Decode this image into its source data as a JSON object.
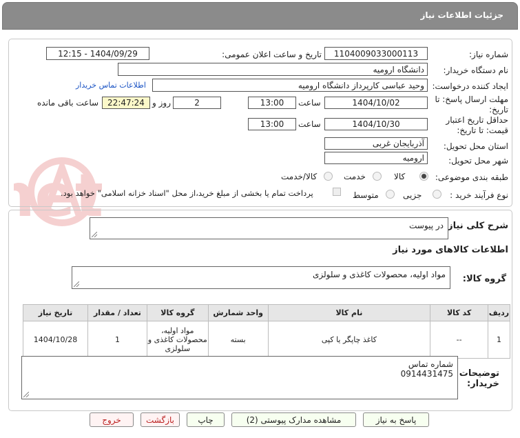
{
  "header": {
    "title": "جزئیات اطلاعات نیاز"
  },
  "need_number": {
    "label": "شماره نیاز:",
    "value": "1104009033000113"
  },
  "announce": {
    "label": "تاریخ و ساعت اعلان عمومی:",
    "value": "1404/09/29 - 12:15"
  },
  "buyer_org": {
    "label": "نام دستگاه خریدار:",
    "value": "دانشگاه ارومیه"
  },
  "requester": {
    "label": "ایجاد کننده درخواست:",
    "value": "وحید عباسی کارپرداز دانشگاه ارومیه",
    "contact_link": "اطلاعات تماس خریدار"
  },
  "deadline": {
    "label1": "مهلت ارسال پاسخ: تا",
    "label2": "تاریخ:",
    "date": "1404/10/02",
    "time_label": "ساعت",
    "time": "13:00",
    "days": "2",
    "days_label": "روز و",
    "remaining": "22:47:24",
    "remaining_label": "ساعت باقی مانده"
  },
  "validity": {
    "label1": "حداقل تاریخ اعتبار",
    "label2": "قیمت: تا تاریخ:",
    "date": "1404/10/30",
    "time_label": "ساعت",
    "time": "13:00"
  },
  "province": {
    "label": "استان محل تحویل:",
    "value": "آذربایجان غربی"
  },
  "city": {
    "label": "شهر محل تحویل:",
    "value": "ارومیه"
  },
  "category": {
    "label": "طبقه بندی موضوعی:",
    "options": [
      "کالا",
      "خدمت",
      "کالا/خدمت"
    ],
    "selected": 0
  },
  "purchase": {
    "label": "نوع فرآیند خرید :",
    "options": [
      "جزیی",
      "متوسط"
    ],
    "payment_note": "پرداخت تمام یا بخشی از مبلغ خرید،از محل \"اسناد خزانه اسلامی\" خواهد بود."
  },
  "description": {
    "label": "شرح کلی نیاز:",
    "value": "در پیوست"
  },
  "goods_info": {
    "label": "اطلاعات کالاهای مورد نیاز"
  },
  "goods_group": {
    "label": "گروه کالا:",
    "value": "مواد اولیه، محصولات کاغذی و سلولزی"
  },
  "table": {
    "headers": [
      "ردیف",
      "کد کالا",
      "نام کالا",
      "واحد شمارش",
      "گروه کالا",
      "تعداد / مقدار",
      "تاریخ نیاز"
    ],
    "rows": [
      [
        "1",
        "--",
        "کاغذ چاپگر یا کپی",
        "بسته",
        "مواد اولیه، محصولات کاغذی و سلولزی",
        "1",
        "1404/10/28"
      ]
    ]
  },
  "buyer_notes": {
    "label1": "توضیحات",
    "label2": "خریدار:",
    "line1": "شماره تماس",
    "line2": "0914431475"
  },
  "buttons": {
    "reply": "پاسخ به نیاز",
    "docs": "مشاهده مدارک پیوستی (2)",
    "print": "چاپ",
    "back": "بازگشت",
    "exit": "خروج"
  },
  "watermark": {
    "text": "AriaTender.net"
  },
  "colors": {
    "header_bg": "#8b8b8b",
    "remaining_bg": "#fbf8c9",
    "link": "#1a53c4",
    "watermark": "#d32f2f"
  }
}
